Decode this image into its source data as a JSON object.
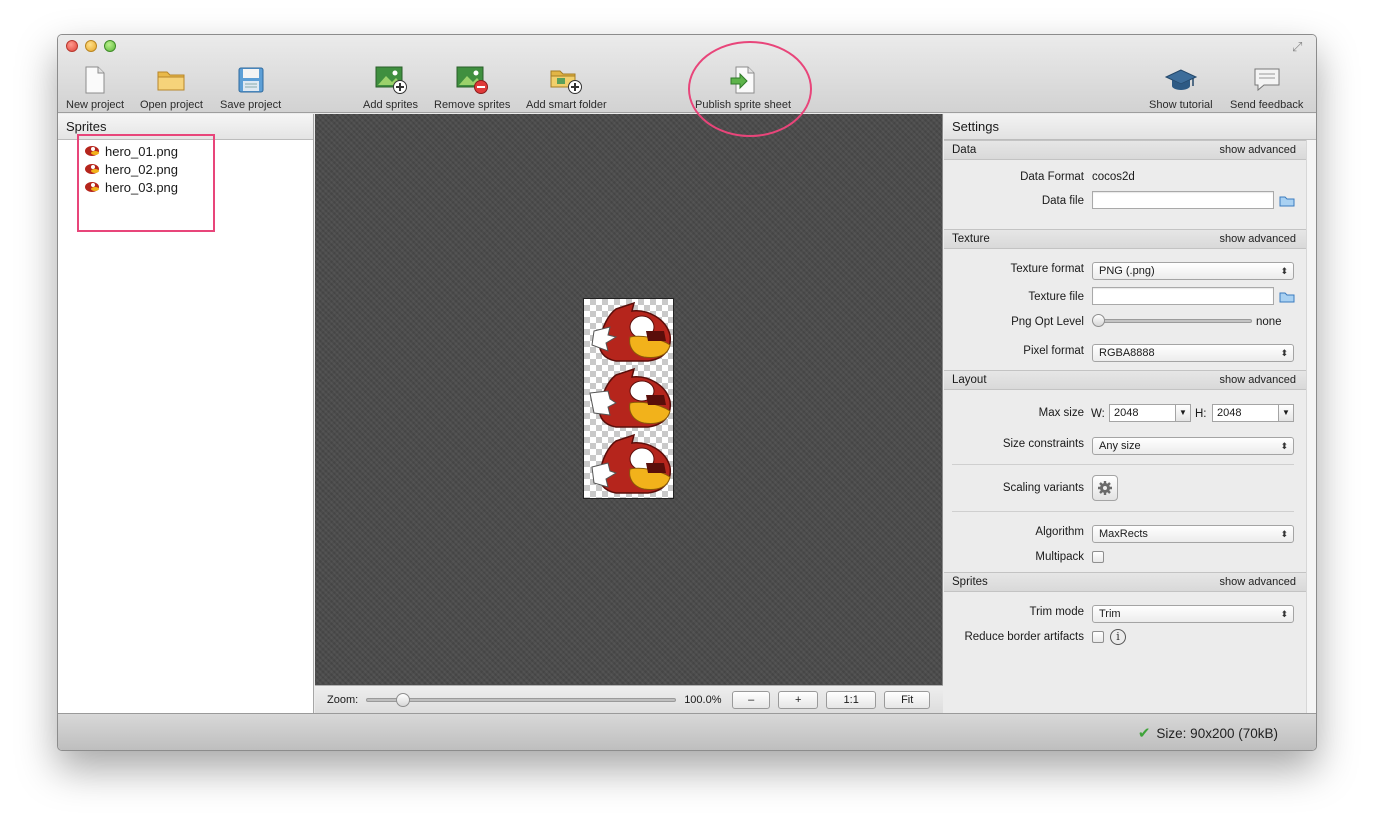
{
  "toolbar": {
    "new_project": "New project",
    "open_project": "Open project",
    "save_project": "Save project",
    "add_sprites": "Add sprites",
    "remove_sprites": "Remove sprites",
    "add_smart_folder": "Add smart folder",
    "publish": "Publish sprite sheet",
    "show_tutorial": "Show tutorial",
    "send_feedback": "Send feedback"
  },
  "sprites_panel": {
    "title": "Sprites",
    "items": [
      "hero_01.png",
      "hero_02.png",
      "hero_03.png"
    ]
  },
  "zoom": {
    "label": "Zoom:",
    "value": "100.0%",
    "level": 0.1,
    "minus": "–",
    "plus": "+",
    "one_to_one": "1:1",
    "fit": "Fit"
  },
  "settings": {
    "title": "Settings",
    "show_advanced": "show advanced",
    "data": {
      "header": "Data",
      "format_label": "Data Format",
      "format_value": "cocos2d",
      "file_label": "Data file",
      "file_value": ""
    },
    "texture": {
      "header": "Texture",
      "format_label": "Texture format",
      "format_value": "PNG (.png)",
      "file_label": "Texture file",
      "file_value": "",
      "opt_label": "Png Opt Level",
      "opt_value": "none",
      "pixel_label": "Pixel format",
      "pixel_value": "RGBA8888"
    },
    "layout": {
      "header": "Layout",
      "max_size_label": "Max size",
      "w_label": "W:",
      "w_value": "2048",
      "h_label": "H:",
      "h_value": "2048",
      "constraints_label": "Size constraints",
      "constraints_value": "Any size",
      "scaling_label": "Scaling variants",
      "algorithm_label": "Algorithm",
      "algorithm_value": "MaxRects",
      "multipack_label": "Multipack"
    },
    "sprites": {
      "header": "Sprites",
      "trim_label": "Trim mode",
      "trim_value": "Trim",
      "reduce_label": "Reduce border artifacts"
    }
  },
  "status": {
    "text": "Size: 90x200 (70kB)"
  },
  "colors": {
    "highlight": "#e8457a",
    "canvas": "#4a4a4a",
    "hero_red": "#b5251c",
    "hero_beak": "#f2b21b"
  }
}
